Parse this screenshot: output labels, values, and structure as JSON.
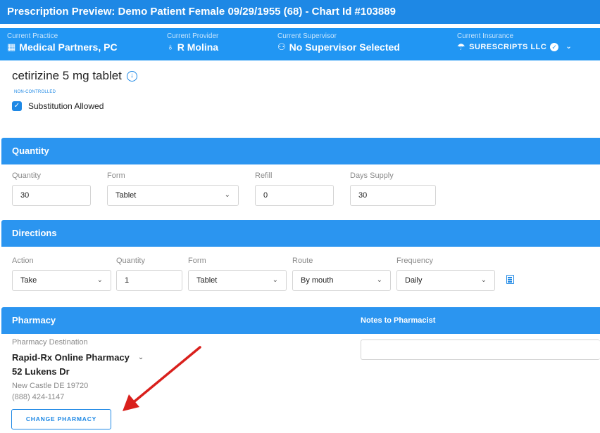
{
  "title": "Prescription Preview: Demo Patient Female 09/29/1955 (68) - Chart Id #103889",
  "context": {
    "practice": {
      "label": "Current Practice",
      "value": "Medical Partners, PC",
      "icon": "building-icon"
    },
    "provider": {
      "label": "Current Provider",
      "value": "R Molina",
      "icon": "stethoscope-icon"
    },
    "supervisor": {
      "label": "Current Supervisor",
      "value": "No Supervisor Selected",
      "icon": "people-icon"
    },
    "insurance": {
      "label": "Current Insurance",
      "value": "SURESCRIPTS LLC",
      "icon": "umbrella-icon"
    }
  },
  "drug": {
    "name": "cetirizine 5 mg tablet",
    "schedule": "NON-CONTROLLED",
    "substitution_label": "Substitution Allowed",
    "substitution_checked": true
  },
  "quantity_section": {
    "heading": "Quantity",
    "quantity_label": "Quantity",
    "quantity_value": "30",
    "form_label": "Form",
    "form_value": "Tablet",
    "refill_label": "Refill",
    "refill_value": "0",
    "days_label": "Days Supply",
    "days_value": "30"
  },
  "directions_section": {
    "heading": "Directions",
    "action_label": "Action",
    "action_value": "Take",
    "quantity_label": "Quantity",
    "quantity_value": "1",
    "form_label": "Form",
    "form_value": "Tablet",
    "route_label": "Route",
    "route_value": "By mouth",
    "frequency_label": "Frequency",
    "frequency_value": "Daily"
  },
  "pharmacy_section": {
    "heading": "Pharmacy",
    "notes_heading": "Notes to Pharmacist",
    "destination_label": "Pharmacy Destination",
    "name": "Rapid-Rx Online Pharmacy",
    "address": "52 Lukens Dr",
    "city": "New Castle DE 19720",
    "phone": "(888) 424-1147",
    "change_button": "CHANGE PHARMACY"
  },
  "colors": {
    "header": "#1e88e5",
    "section": "#2b95f0",
    "annotation_arrow": "#d9201c"
  }
}
